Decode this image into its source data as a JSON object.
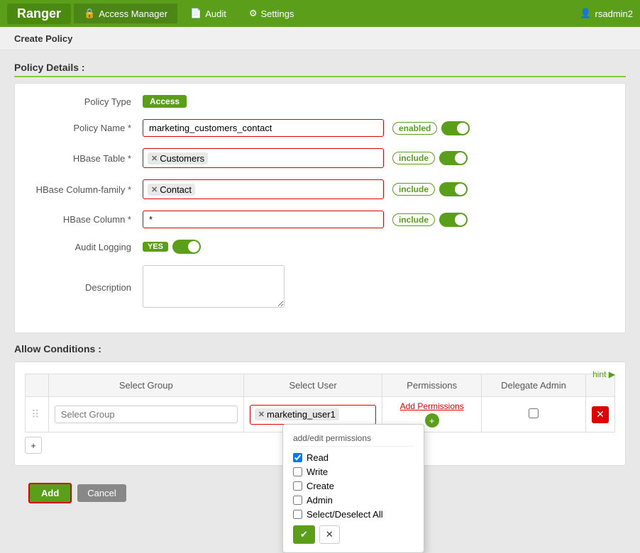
{
  "topbar": {
    "brand": "Ranger",
    "nav_items": [
      {
        "id": "access-manager",
        "label": "Access Manager",
        "icon": "🔒",
        "active": true
      },
      {
        "id": "audit",
        "label": "Audit",
        "icon": "📄",
        "active": false
      },
      {
        "id": "settings",
        "label": "Settings",
        "icon": "⚙",
        "active": false
      }
    ],
    "user": {
      "icon": "👤",
      "name": "rsadmin2"
    }
  },
  "page": {
    "header": "Create Policy"
  },
  "policy_details": {
    "section_title": "Policy Details :",
    "policy_type": {
      "label": "Policy Type",
      "badge": "Access"
    },
    "policy_name": {
      "label": "Policy Name *",
      "value": "marketing_customers_contact",
      "toggle_label": "enabled",
      "toggle_on": true
    },
    "hbase_table": {
      "label": "HBase Table *",
      "tag": "Customers",
      "toggle_label": "include",
      "toggle_on": true
    },
    "hbase_column_family": {
      "label": "HBase Column-family *",
      "tag": "Contact",
      "toggle_label": "include",
      "toggle_on": true
    },
    "hbase_column": {
      "label": "HBase Column *",
      "value": "*",
      "toggle_label": "include",
      "toggle_on": true
    },
    "audit_logging": {
      "label": "Audit Logging",
      "yes_label": "YES",
      "toggle_on": true
    },
    "description": {
      "label": "Description",
      "placeholder": ""
    }
  },
  "allow_conditions": {
    "section_title": "Allow Conditions :",
    "hint": "hint ▶",
    "table": {
      "headers": [
        "Select Group",
        "Select User",
        "Permissions",
        "Delegate Admin",
        ""
      ],
      "row": {
        "select_group_placeholder": "Select Group",
        "select_user_tag": "marketing_user1",
        "add_permissions_label": "Add Permissions",
        "add_icon": "+"
      }
    },
    "add_row_btn": "+"
  },
  "popup": {
    "title": "add/edit permissions",
    "checkboxes": [
      {
        "id": "read",
        "label": "Read",
        "checked": true
      },
      {
        "id": "write",
        "label": "Write",
        "checked": false
      },
      {
        "id": "create",
        "label": "Create",
        "checked": false
      },
      {
        "id": "admin",
        "label": "Admin",
        "checked": false
      },
      {
        "id": "select-deselect-all",
        "label": "Select/Deselect All",
        "checked": false
      }
    ],
    "btn_ok": "✔",
    "btn_cancel": "✕"
  },
  "bottom_buttons": {
    "add_label": "Add",
    "cancel_label": "Cancel"
  }
}
